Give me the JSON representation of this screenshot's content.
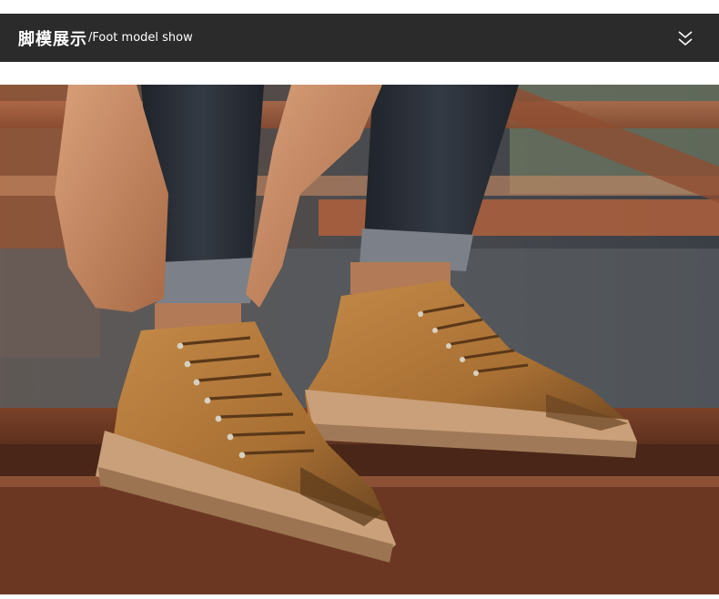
{
  "header": {
    "title_cn": "脚模展示",
    "title_en": "/Foot model show",
    "expand_icon": "double-chevron-down-icon"
  },
  "photo": {
    "subject": "model-foot-boots-photo",
    "colors": {
      "boot": "#b07a3c",
      "denim": "#2c3038",
      "rust": "#8a4a2e",
      "header_bg": "#2b2b2b"
    }
  }
}
